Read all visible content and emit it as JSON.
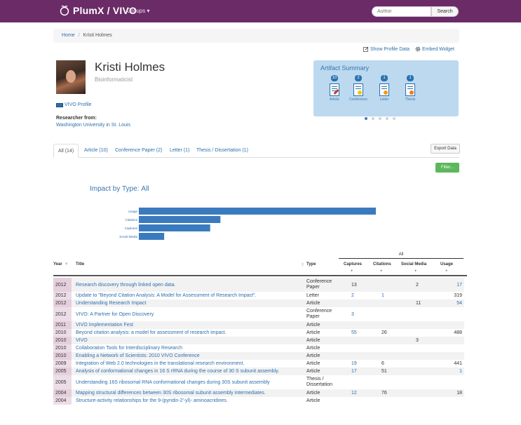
{
  "nav": {
    "brand": "PlumX / VIVO",
    "groups": "Groups ",
    "search_placeholder": "Author",
    "search_button": "Search"
  },
  "breadcrumb": {
    "home": "Home",
    "current": "Kristi Holmes"
  },
  "actions": {
    "show_profile": "Show Profile Data",
    "embed_widget": "Embed Widget"
  },
  "profile": {
    "name": "Kristi Holmes",
    "title": "Bioinformaticist",
    "vivo_link": "VIVO Profile",
    "researcher_from_label": "Researcher from:",
    "institution": "Washington University in St. Louis"
  },
  "artifact_summary": {
    "title": "Artifact Summary",
    "items": [
      {
        "label": "Article",
        "count": "10"
      },
      {
        "label": "Conference",
        "count": "2"
      },
      {
        "label": "Letter",
        "count": "1"
      },
      {
        "label": "Thesis",
        "count": "1"
      }
    ]
  },
  "tabs": [
    "All (14)",
    "Article (10)",
    "Conference Paper (2)",
    "Letter (1)",
    "Thesis / Dissertation (1)"
  ],
  "buttons": {
    "export": "Export Data",
    "filter": "Filter..."
  },
  "impact": {
    "label": "Impact by Type:",
    "selection": "All"
  },
  "chart_data": {
    "type": "bar",
    "orientation": "horizontal",
    "categories": [
      "Usage",
      "Citations",
      "Captures",
      "Social Media"
    ],
    "values": [
      1319,
      454,
      397,
      141
    ],
    "color": "#3a7bbf"
  },
  "table": {
    "group_label": "All",
    "headers": {
      "year": "Year",
      "title": "Title",
      "type": "Type",
      "captures": "Captures",
      "citations": "Citations",
      "social": "Social Media",
      "usage": "Usage"
    },
    "rows": [
      {
        "year": "2012",
        "title": "Research discovery through linked open data.",
        "type": "Conference Paper",
        "captures": "13",
        "citations": "",
        "social": "2",
        "usage": "17"
      },
      {
        "year": "2012",
        "title": "Update to \"Beyond Citation Analysis: A Model for Assessment of Research Impact\".",
        "type": "Letter",
        "captures": "2",
        "citations": "1",
        "social": "",
        "usage": "319"
      },
      {
        "year": "2012",
        "title": "Understanding Research Impact",
        "type": "Article",
        "captures": "",
        "citations": "",
        "social": "11",
        "usage": "54"
      },
      {
        "year": "2012",
        "title": "VIVO: A Partner for Open Discovery",
        "type": "Conference Paper",
        "captures": "3",
        "citations": "",
        "social": "",
        "usage": ""
      },
      {
        "year": "2011",
        "title": "VIVO Implementation Fest",
        "type": "Article",
        "captures": "",
        "citations": "",
        "social": "",
        "usage": ""
      },
      {
        "year": "2010",
        "title": "Beyond citation analysis: a model for assessment of research impact.",
        "type": "Article",
        "captures": "55",
        "citations": "26",
        "social": "",
        "usage": "488"
      },
      {
        "year": "2010",
        "title": "VIVO",
        "type": "Article",
        "captures": "",
        "citations": "",
        "social": "3",
        "usage": ""
      },
      {
        "year": "2010",
        "title": "Collaboration Tools for Interdisciplinary Research",
        "type": "Article",
        "captures": "",
        "citations": "",
        "social": "",
        "usage": ""
      },
      {
        "year": "2010",
        "title": "Enabling a Network of Scientists: 2010 VIVO Conference",
        "type": "Article",
        "captures": "",
        "citations": "",
        "social": "",
        "usage": ""
      },
      {
        "year": "2009",
        "title": "Integration of Web 2.0 technologies in the translational research environment.",
        "type": "Article",
        "captures": "19",
        "citations": "6",
        "social": "",
        "usage": "441"
      },
      {
        "year": "2005",
        "title": "Analysis of conformational changes in 16 S rRNA during the course of 30 S subunit assembly.",
        "type": "Article",
        "captures": "17",
        "citations": "51",
        "social": "",
        "usage": "1"
      },
      {
        "year": "2005",
        "title": "Understanding 16S ribosomal RNA conformational changes during 30S subunit assembly",
        "type": "Thesis / Dissertation",
        "captures": "",
        "citations": "",
        "social": "",
        "usage": ""
      },
      {
        "year": "2004",
        "title": "Mapping structural differences between 30S ribosomal subunit assembly intermediates.",
        "type": "Article",
        "captures": "12",
        "citations": "76",
        "social": "",
        "usage": "18"
      },
      {
        "year": "2004",
        "title": "Structure-activity relationships for the 9-(pyridin-2'-yl)- aminoacridines.",
        "type": "Article",
        "captures": "",
        "citations": "",
        "social": "",
        "usage": ""
      }
    ]
  }
}
